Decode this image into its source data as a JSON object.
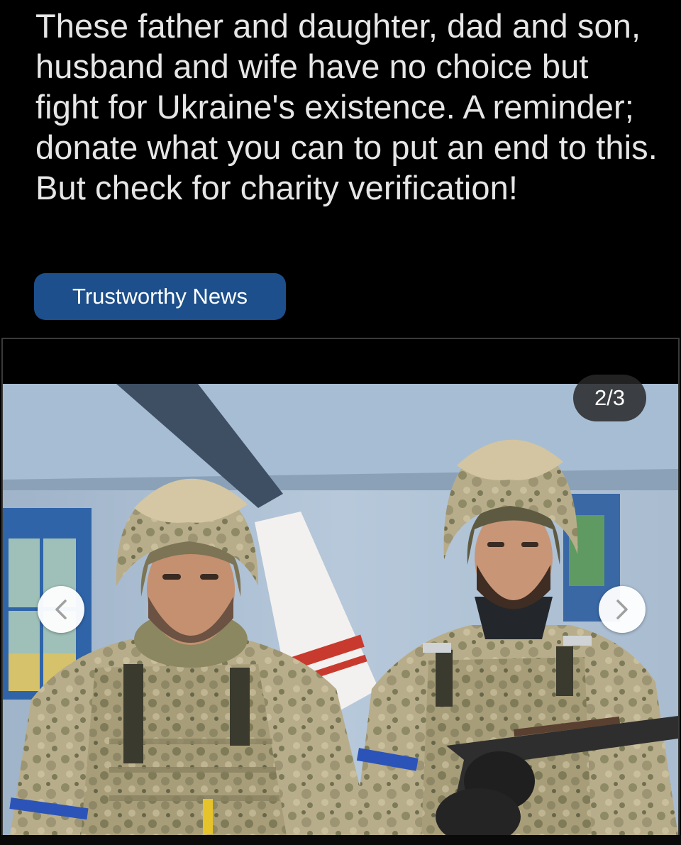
{
  "post": {
    "text": "These father and daughter, dad and son, husband and wife have no choice but fight for Ukraine's existence. A reminder; donate what you can to put an end to this. But check for charity verification!",
    "tag_label": "Trustworthy News"
  },
  "carousel": {
    "counter": "2/3",
    "current_index": 2,
    "total": 3,
    "prev_icon": "chevron-left-icon",
    "next_icon": "chevron-right-icon",
    "photo": "two-soldiers-in-camouflage-photo"
  },
  "colors": {
    "background": "#000000",
    "text": "#e6e6e6",
    "tag_background": "#1c4f8b",
    "counter_background": "#282828"
  }
}
